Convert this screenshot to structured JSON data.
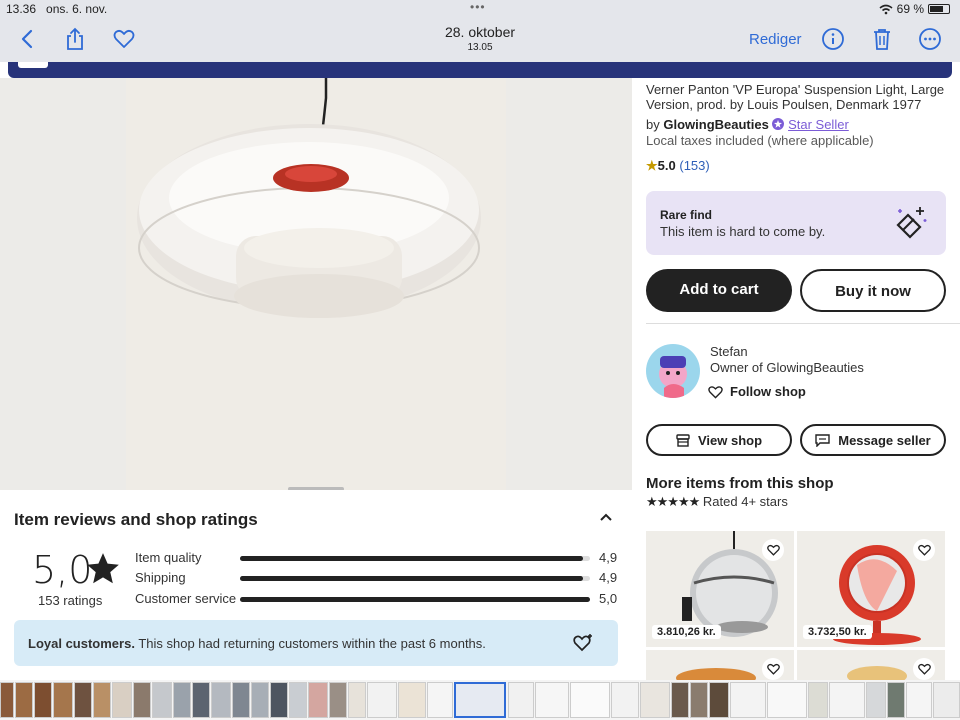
{
  "status_bar": {
    "time": "13.36",
    "date": "ons. 6. nov.",
    "battery": "69 %"
  },
  "toolbar": {
    "title": "28. oktober",
    "subtitle": "13.05",
    "edit_label": "Rediger"
  },
  "product": {
    "title": "Verner Panton 'VP Europa' Suspension Light, Large Version, prod. by Louis Poulsen, Denmark 1977",
    "by_prefix": "by",
    "shop_name": "GlowingBeauties",
    "star_seller": "Star Seller",
    "taxes": "Local taxes included (where applicable)",
    "rating": "5.0",
    "rating_count": "(153)"
  },
  "rare_find": {
    "heading": "Rare find",
    "text": "This item is hard to come by."
  },
  "buttons": {
    "add_to_cart": "Add to cart",
    "buy_now": "Buy it now",
    "view_shop": "View shop",
    "message_seller": "Message seller",
    "follow_shop": "Follow shop"
  },
  "owner": {
    "name": "Stefan",
    "role": "Owner of GlowingBeauties"
  },
  "more_items": {
    "heading": "More items from this shop",
    "stars": "★★★★★",
    "subtitle": "Rated 4+ stars",
    "items": [
      {
        "price": "3.810,26 kr."
      },
      {
        "price": "3.732,50 kr."
      }
    ]
  },
  "reviews": {
    "heading": "Item reviews and shop ratings",
    "score": "5,0",
    "ratings_count": "153 ratings",
    "rows": [
      {
        "label": "Item quality",
        "value": "4,9",
        "fraction": 0.98
      },
      {
        "label": "Shipping",
        "value": "4,9",
        "fraction": 0.98
      },
      {
        "label": "Customer service",
        "value": "5,0",
        "fraction": 1.0
      }
    ],
    "loyal_bold": "Loyal customers.",
    "loyal_text": "This shop had returning customers within the past 6 months."
  },
  "colors": {
    "accent_blue": "#2f6bd6",
    "banner": "#27337a",
    "rare_bg": "#e8e3f5",
    "loyal_bg": "#d7ebf7",
    "star_seller": "#7b5cd6"
  }
}
